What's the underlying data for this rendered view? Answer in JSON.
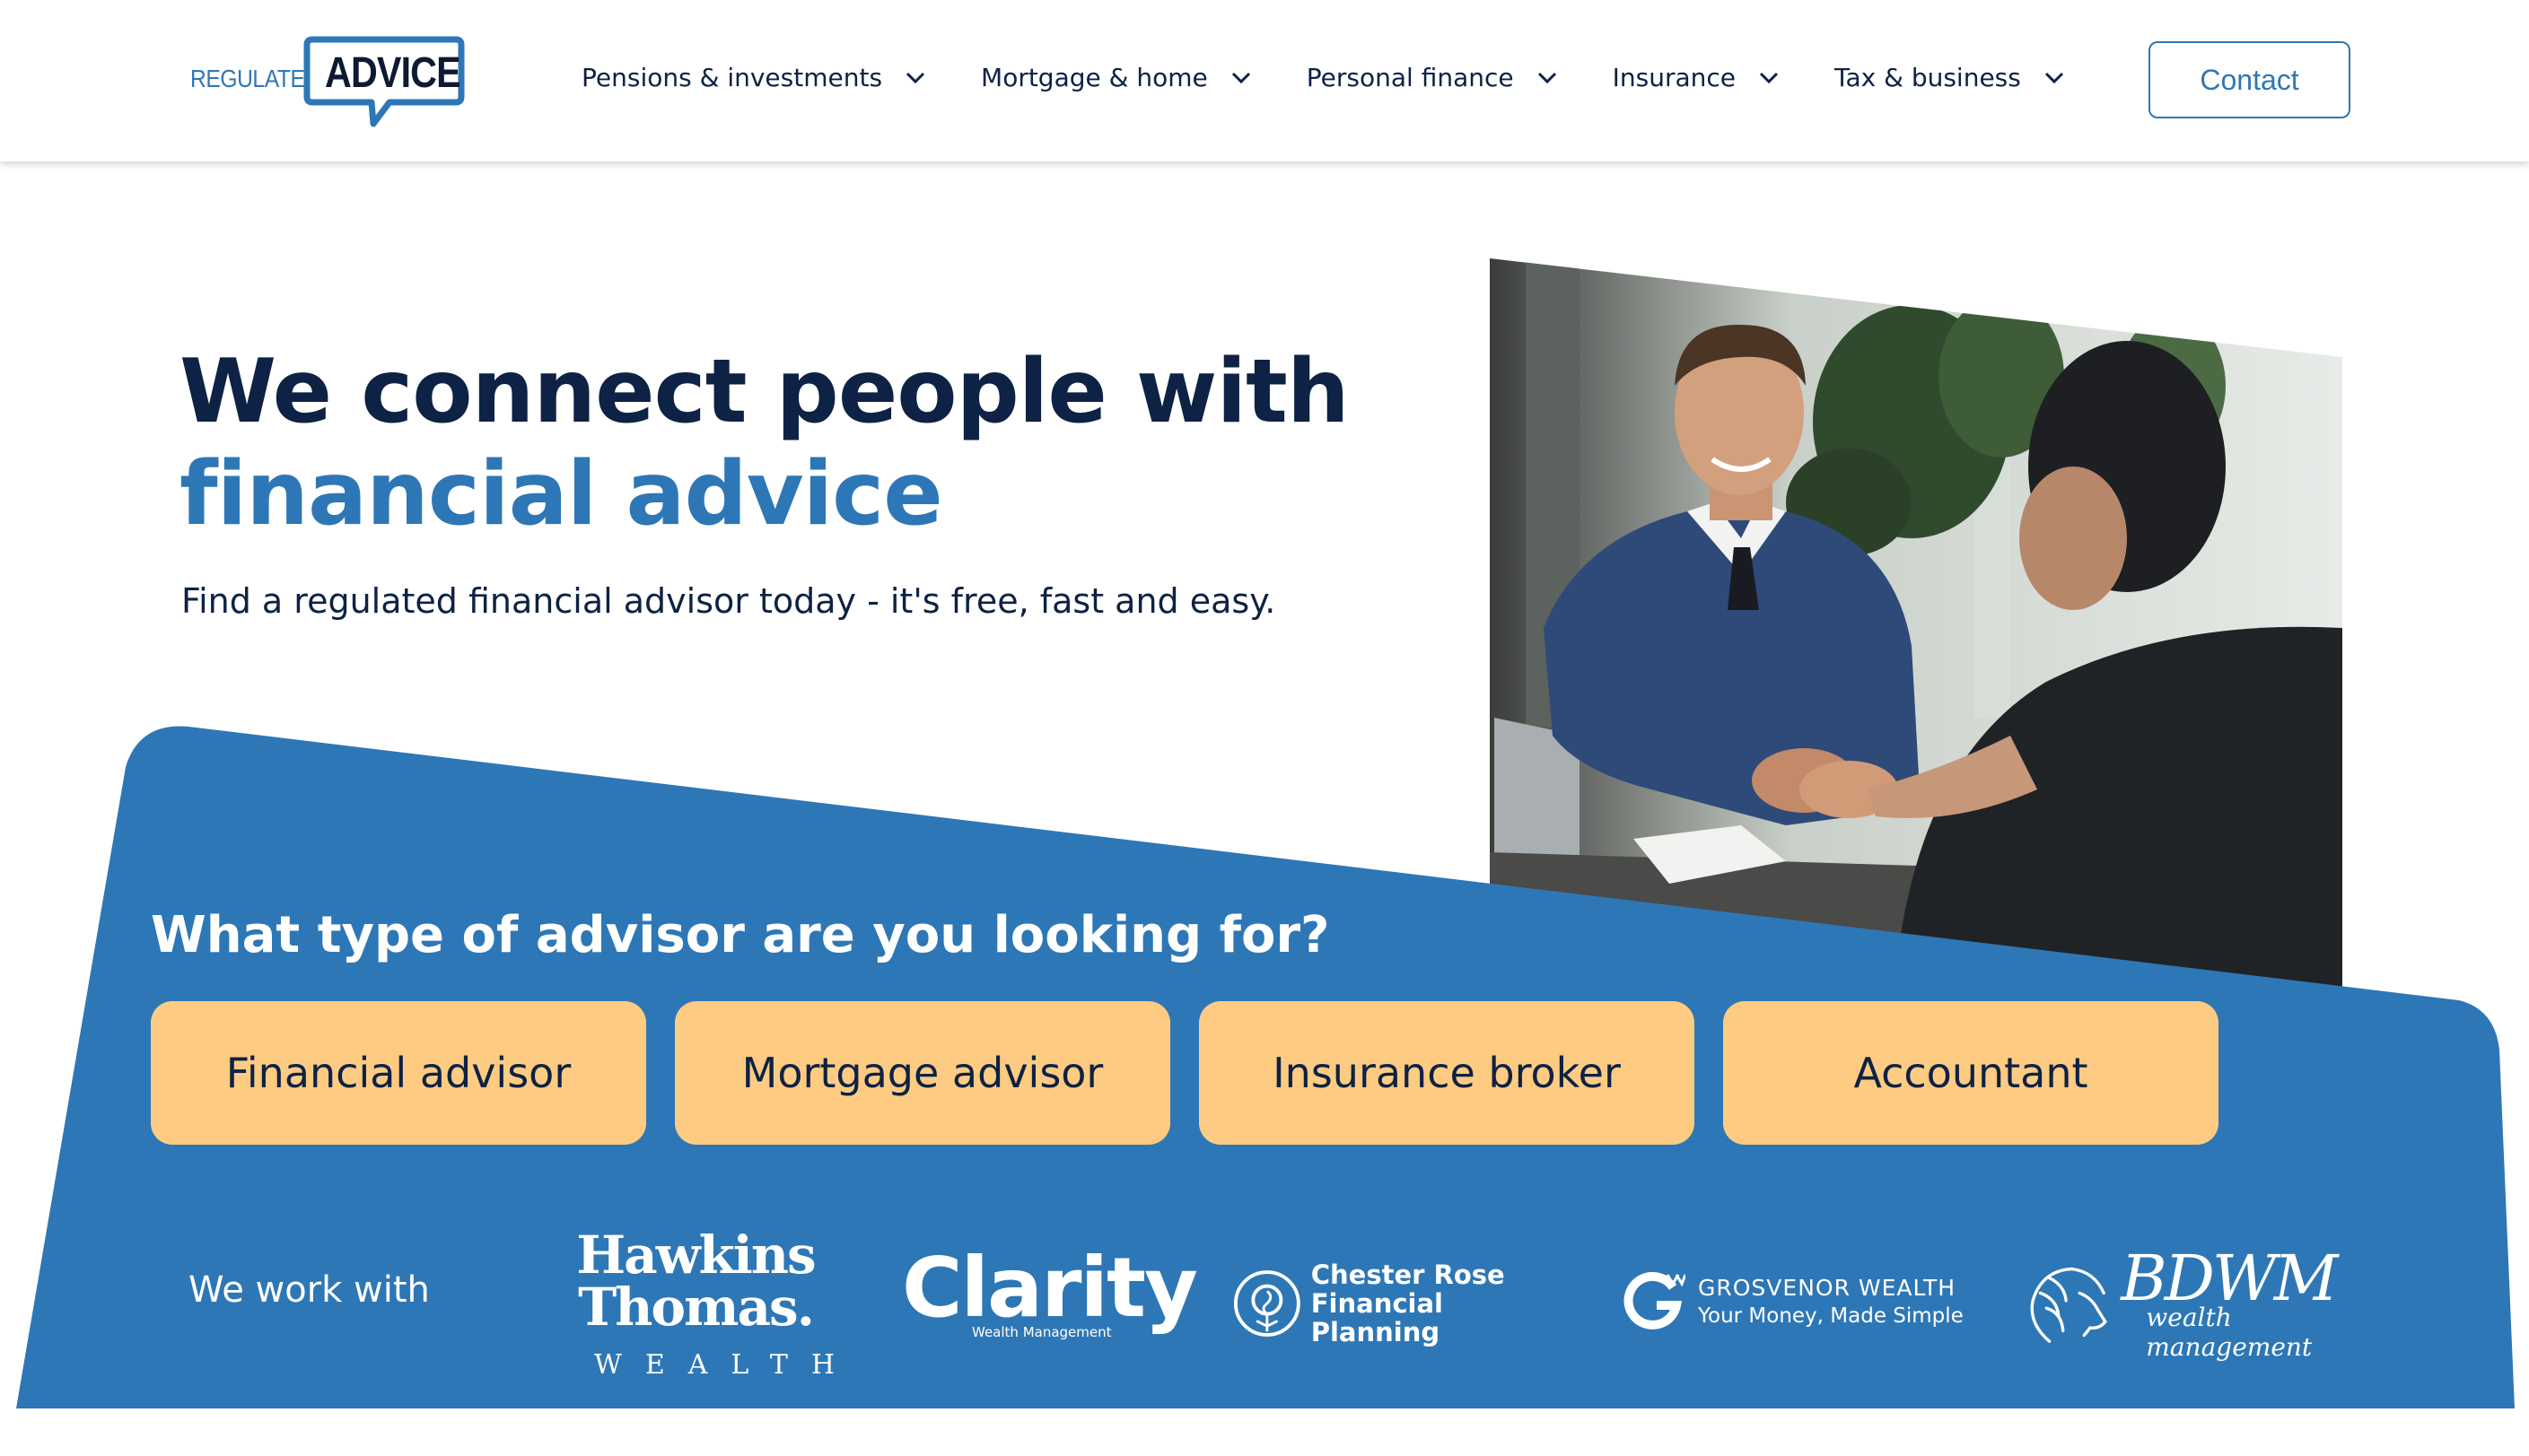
{
  "header": {
    "logo": {
      "regulated": "REGULATED",
      "advice": "ADVICE"
    },
    "nav": [
      {
        "label": "Pensions & investments"
      },
      {
        "label": "Mortgage & home"
      },
      {
        "label": "Personal finance"
      },
      {
        "label": "Insurance"
      },
      {
        "label": "Tax & business"
      }
    ],
    "contact_label": "Contact"
  },
  "hero": {
    "title_line1": "We connect people with",
    "title_line2": "financial advice",
    "subtitle": "Find a regulated financial advisor today - it's free, fast and easy."
  },
  "advisor_section": {
    "question": "What type of advisor are you looking for?",
    "options": [
      {
        "label": "Financial advisor"
      },
      {
        "label": "Mortgage advisor"
      },
      {
        "label": "Insurance broker"
      },
      {
        "label": "Accountant"
      }
    ]
  },
  "partners": {
    "intro": "We work with",
    "hawkins": {
      "l1": "Hawkins",
      "l2": "Thomas.",
      "l3": "WEALTH"
    },
    "clarity": {
      "name": "Clarity",
      "tag": "Wealth Management"
    },
    "chester": {
      "l1": "Chester Rose",
      "l2": "Financial Planning"
    },
    "grosvenor": {
      "l1": "GROSVENOR WEALTH",
      "l2": "Your Money, Made Simple"
    },
    "bdwm": {
      "l1": "BDWM",
      "l2": "wealth management"
    }
  },
  "colors": {
    "navy": "#0d2244",
    "brand_blue": "#2e77b6",
    "button_peach": "#fecb82"
  }
}
